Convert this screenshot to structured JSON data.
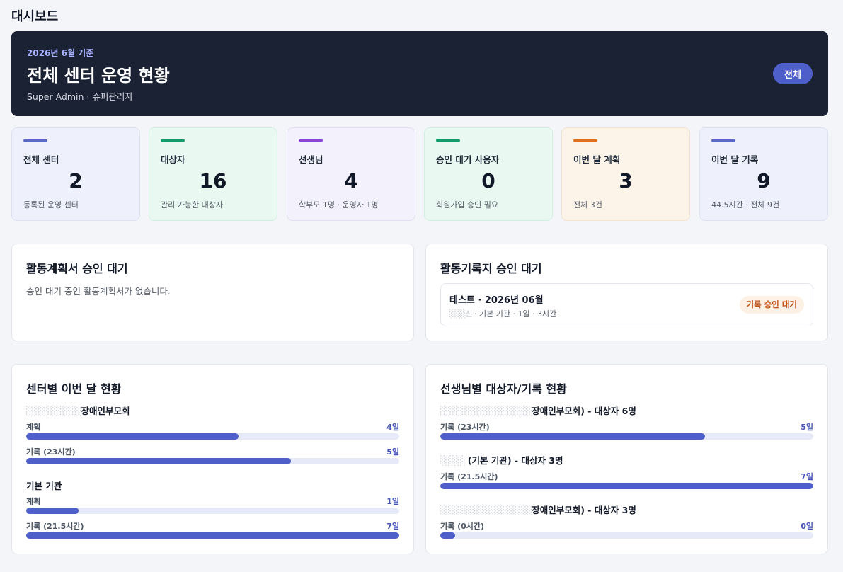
{
  "page": {
    "title": "대시보드"
  },
  "hero": {
    "date": "2026년 6월 기준",
    "title": "전체 센터 운영 현황",
    "subtitle": "Super Admin · 슈퍼관리자",
    "scope_button": "전체"
  },
  "stats": [
    {
      "label": "전체 센터",
      "value": "2",
      "note": "등록된 운영 센터",
      "accent": "#5b68c7",
      "bg": "#eef0fb",
      "border": "#dde1f2"
    },
    {
      "label": "대상자",
      "value": "16",
      "note": "관리 가능한 대상자",
      "accent": "#139c6b",
      "bg": "#e9f8f1",
      "border": "#d3efe2"
    },
    {
      "label": "선생님",
      "value": "4",
      "note": "학부모 1명 · 운영자 1명",
      "accent": "#8a45d6",
      "bg": "#f3f1fb",
      "border": "#e3def3"
    },
    {
      "label": "승인 대기 사용자",
      "value": "0",
      "note": "회원가입 승인 필요",
      "accent": "#139c6b",
      "bg": "#e9f8f1",
      "border": "#d3efe2"
    },
    {
      "label": "이번 달 계획",
      "value": "3",
      "note": "전체 3건",
      "accent": "#e0701e",
      "bg": "#fdf4e9",
      "border": "#f2e2cf"
    },
    {
      "label": "이번 달 기록",
      "value": "9",
      "note": "44.5시간 · 전체 9건",
      "accent": "#5b68c7",
      "bg": "#eef0fb",
      "border": "#dde1f2"
    }
  ],
  "plan_approval": {
    "title": "활동계획서 승인 대기",
    "empty_message": "승인 대기 중인 활동계획서가 없습니다."
  },
  "record_approval": {
    "title": "활동기록지 승인 대기",
    "items": [
      {
        "title": "테스트 · 2026년 06월",
        "meta_redacted": "░░░신",
        "meta": " · 기본 기관 · 1일 · 3시간",
        "badge": "기록 승인 대기"
      }
    ]
  },
  "center_status": {
    "title": "센터별 이번 달 현황",
    "groups": [
      {
        "name_redacted": "░░░░░░░░░",
        "name": "장애인부모회",
        "rows": [
          {
            "label": "계획",
            "value": "4일",
            "fraction": 0.57
          },
          {
            "label": "기록 (23시간)",
            "value": "5일",
            "fraction": 0.71
          }
        ]
      },
      {
        "name_redacted": "",
        "name": "기본 기관",
        "rows": [
          {
            "label": "계획",
            "value": "1일",
            "fraction": 0.14
          },
          {
            "label": "기록 (21.5시간)",
            "value": "7일",
            "fraction": 1.0
          }
        ]
      }
    ]
  },
  "teacher_status": {
    "title": "선생님별 대상자/기록 현황",
    "groups": [
      {
        "name_redacted": "░░░░░░░░░░░░░░░",
        "name": "장애인부모회) - 대상자 6명",
        "rows": [
          {
            "label": "기록 (23시간)",
            "value": "5일",
            "fraction": 0.71
          }
        ]
      },
      {
        "name_redacted": "░░░░",
        "name": " (기본 기관) - 대상자 3명",
        "rows": [
          {
            "label": "기록 (21.5시간)",
            "value": "7일",
            "fraction": 1.0
          }
        ]
      },
      {
        "name_redacted": "░░░░░░░░░░░░░░░",
        "name": "장애인부모회) - 대상자 3명",
        "rows": [
          {
            "label": "기록 (0시간)",
            "value": "0일",
            "fraction": 0.04
          }
        ]
      }
    ]
  }
}
